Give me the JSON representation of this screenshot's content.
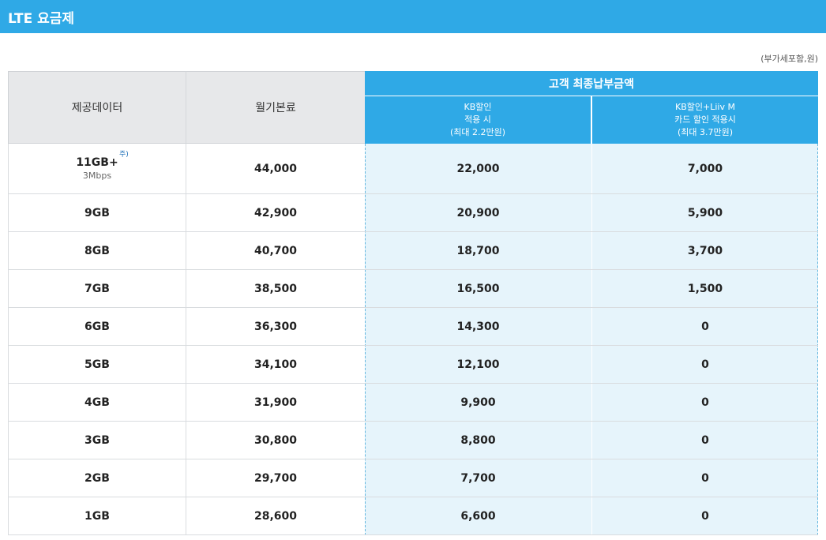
{
  "page": {
    "title": "LTE 요금제",
    "unit_note": "(부가세포함,원)"
  },
  "table": {
    "header": {
      "data": "제공데이터",
      "monthly_fee": "월기본료",
      "customer_final": "고객 최종납부금액",
      "kb_discount_line1": "KB할인",
      "kb_discount_line2": "적용 시",
      "kb_discount_line3": "(최대 2.2만원)",
      "kb_liiv_line1": "KB할인+Liiv M",
      "kb_liiv_line2": "카드 할인 적용시",
      "kb_liiv_line3": "(최대 3.7만원)"
    },
    "rows": [
      {
        "data": "11GB+",
        "note_mark": "주)",
        "speed": "3Mbps",
        "monthly": "44,000",
        "kb": "22,000",
        "kb_liiv": "7,000"
      },
      {
        "data": "9GB",
        "monthly": "42,900",
        "kb": "20,900",
        "kb_liiv": "5,900"
      },
      {
        "data": "8GB",
        "monthly": "40,700",
        "kb": "18,700",
        "kb_liiv": "3,700"
      },
      {
        "data": "7GB",
        "monthly": "38,500",
        "kb": "16,500",
        "kb_liiv": "1,500"
      },
      {
        "data": "6GB",
        "monthly": "36,300",
        "kb": "14,300",
        "kb_liiv": "0"
      },
      {
        "data": "5GB",
        "monthly": "34,100",
        "kb": "12,100",
        "kb_liiv": "0"
      },
      {
        "data": "4GB",
        "monthly": "31,900",
        "kb": "9,900",
        "kb_liiv": "0"
      },
      {
        "data": "3GB",
        "monthly": "30,800",
        "kb": "8,800",
        "kb_liiv": "0"
      },
      {
        "data": "2GB",
        "monthly": "29,700",
        "kb": "7,700",
        "kb_liiv": "0"
      },
      {
        "data": "1GB",
        "monthly": "28,600",
        "kb": "6,600",
        "kb_liiv": "0"
      }
    ]
  },
  "colors": {
    "accent": "#2fa9e6",
    "header_gray": "#e7e8ea",
    "highlight_bg": "#e6f4fb"
  }
}
